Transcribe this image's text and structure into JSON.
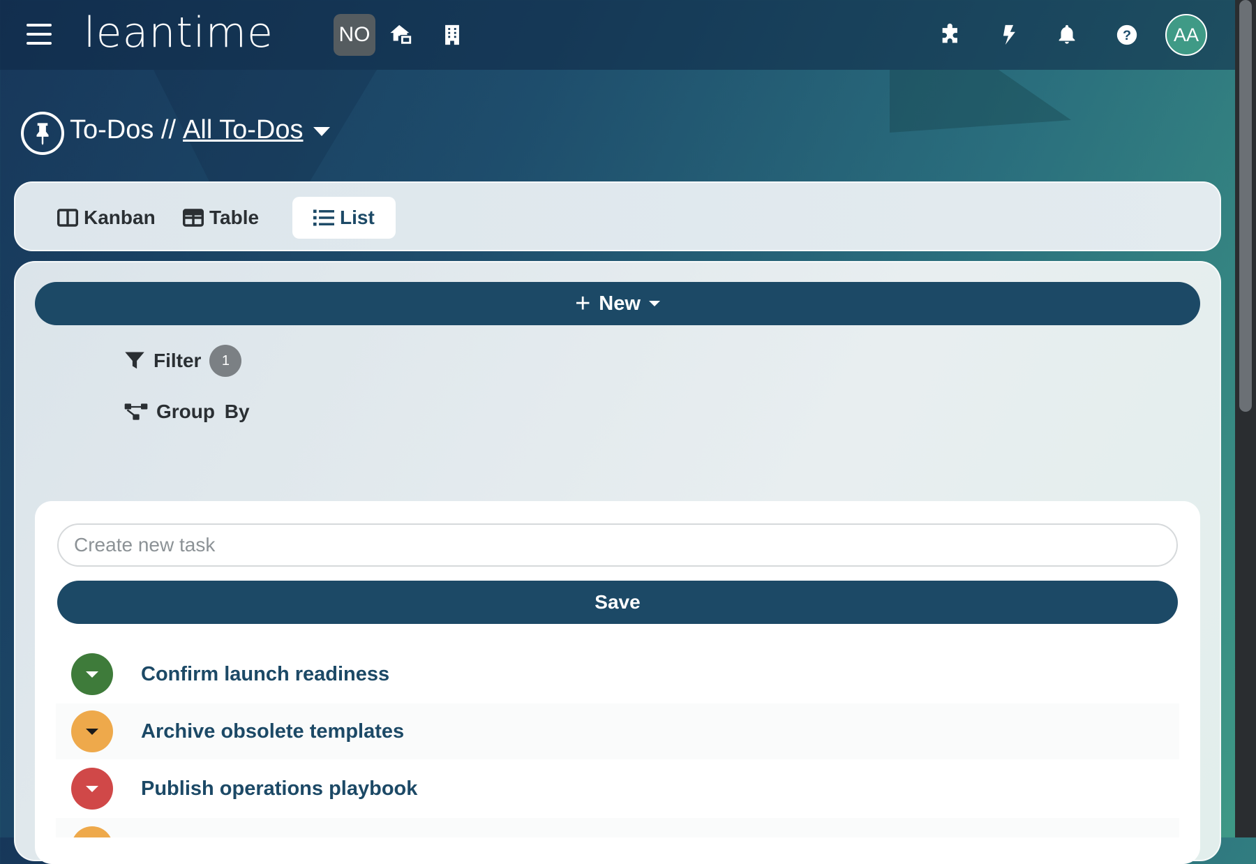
{
  "app": {
    "logo_text": "leantime",
    "company_badge": "NO",
    "avatar_initials": "AA"
  },
  "header": {
    "icons": [
      "menu-icon",
      "home-icon",
      "building-icon",
      "puzzle-icon",
      "bolt-icon",
      "bell-icon",
      "help-icon"
    ]
  },
  "page": {
    "title_prefix": "To-Dos //",
    "title_link": "All To-Dos"
  },
  "tabs": [
    {
      "label": "Kanban",
      "icon": "kanban-icon",
      "active": false
    },
    {
      "label": "Table",
      "icon": "table-icon",
      "active": false
    },
    {
      "label": "List",
      "icon": "list-icon",
      "active": true
    }
  ],
  "toolbar": {
    "new_label": "New",
    "filter_label": "Filter",
    "filter_count": "1",
    "group_by_label": "Group By"
  },
  "quick_add": {
    "placeholder": "Create new task",
    "save_label": "Save"
  },
  "tasks": [
    {
      "title": "Confirm launch readiness",
      "status_color": "#3e7b3a"
    },
    {
      "title": "Archive obsolete templates",
      "status_color": "#eea94b"
    },
    {
      "title": "Publish operations playbook",
      "status_color": "#d04848"
    },
    {
      "title": "",
      "status_color": "#eea94b"
    }
  ],
  "colors": {
    "accent": "#1c4966",
    "success": "#3e7b3a",
    "warning": "#eea94b",
    "danger": "#d04848"
  }
}
